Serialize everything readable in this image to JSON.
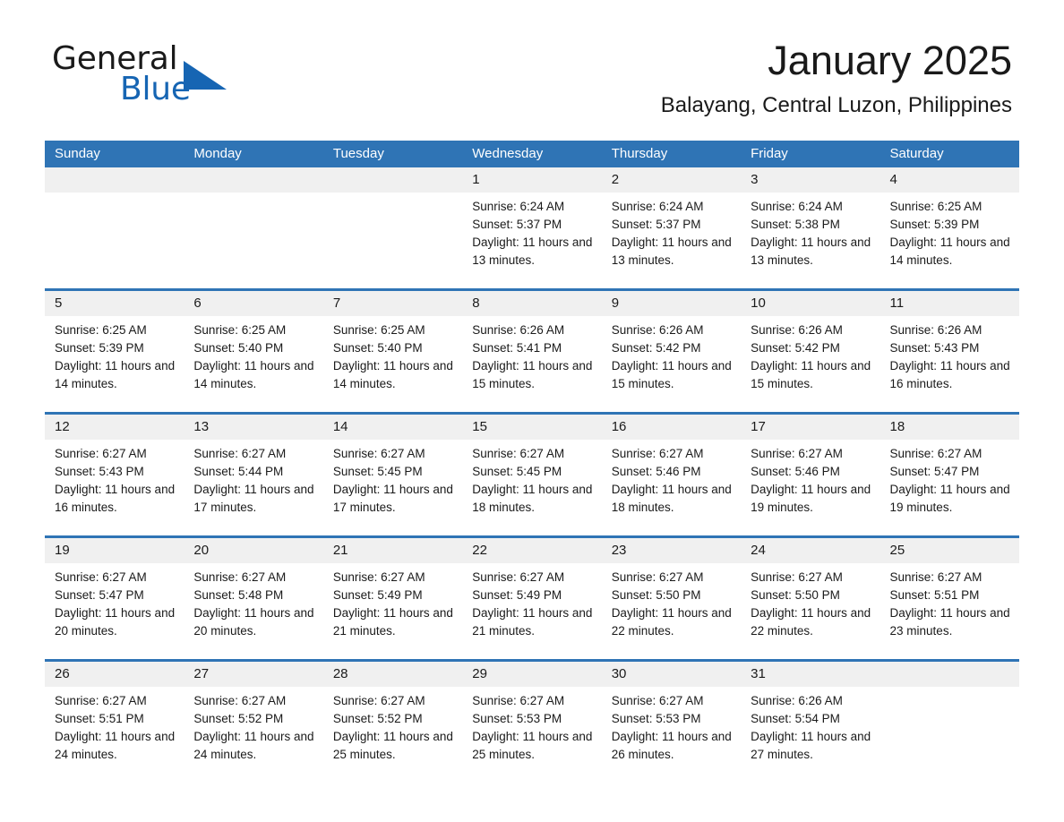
{
  "brand": {
    "name_part1": "General",
    "name_part2": "Blue",
    "accent_color": "#1665b3",
    "triangle_icon": "triangle-icon"
  },
  "header": {
    "month_title": "January 2025",
    "location": "Balayang, Central Luzon, Philippines"
  },
  "theme": {
    "header_blue": "#2f74b5",
    "day_band_gray": "#f0f0f0",
    "text_color": "#1a1a1a"
  },
  "weekdays": [
    "Sunday",
    "Monday",
    "Tuesday",
    "Wednesday",
    "Thursday",
    "Friday",
    "Saturday"
  ],
  "weeks": [
    [
      {
        "day": "",
        "empty": true
      },
      {
        "day": "",
        "empty": true
      },
      {
        "day": "",
        "empty": true
      },
      {
        "day": "1",
        "sunrise": "Sunrise: 6:24 AM",
        "sunset": "Sunset: 5:37 PM",
        "daylight": "Daylight: 11 hours and 13 minutes."
      },
      {
        "day": "2",
        "sunrise": "Sunrise: 6:24 AM",
        "sunset": "Sunset: 5:37 PM",
        "daylight": "Daylight: 11 hours and 13 minutes."
      },
      {
        "day": "3",
        "sunrise": "Sunrise: 6:24 AM",
        "sunset": "Sunset: 5:38 PM",
        "daylight": "Daylight: 11 hours and 13 minutes."
      },
      {
        "day": "4",
        "sunrise": "Sunrise: 6:25 AM",
        "sunset": "Sunset: 5:39 PM",
        "daylight": "Daylight: 11 hours and 14 minutes."
      }
    ],
    [
      {
        "day": "5",
        "sunrise": "Sunrise: 6:25 AM",
        "sunset": "Sunset: 5:39 PM",
        "daylight": "Daylight: 11 hours and 14 minutes."
      },
      {
        "day": "6",
        "sunrise": "Sunrise: 6:25 AM",
        "sunset": "Sunset: 5:40 PM",
        "daylight": "Daylight: 11 hours and 14 minutes."
      },
      {
        "day": "7",
        "sunrise": "Sunrise: 6:25 AM",
        "sunset": "Sunset: 5:40 PM",
        "daylight": "Daylight: 11 hours and 14 minutes."
      },
      {
        "day": "8",
        "sunrise": "Sunrise: 6:26 AM",
        "sunset": "Sunset: 5:41 PM",
        "daylight": "Daylight: 11 hours and 15 minutes."
      },
      {
        "day": "9",
        "sunrise": "Sunrise: 6:26 AM",
        "sunset": "Sunset: 5:42 PM",
        "daylight": "Daylight: 11 hours and 15 minutes."
      },
      {
        "day": "10",
        "sunrise": "Sunrise: 6:26 AM",
        "sunset": "Sunset: 5:42 PM",
        "daylight": "Daylight: 11 hours and 15 minutes."
      },
      {
        "day": "11",
        "sunrise": "Sunrise: 6:26 AM",
        "sunset": "Sunset: 5:43 PM",
        "daylight": "Daylight: 11 hours and 16 minutes."
      }
    ],
    [
      {
        "day": "12",
        "sunrise": "Sunrise: 6:27 AM",
        "sunset": "Sunset: 5:43 PM",
        "daylight": "Daylight: 11 hours and 16 minutes."
      },
      {
        "day": "13",
        "sunrise": "Sunrise: 6:27 AM",
        "sunset": "Sunset: 5:44 PM",
        "daylight": "Daylight: 11 hours and 17 minutes."
      },
      {
        "day": "14",
        "sunrise": "Sunrise: 6:27 AM",
        "sunset": "Sunset: 5:45 PM",
        "daylight": "Daylight: 11 hours and 17 minutes."
      },
      {
        "day": "15",
        "sunrise": "Sunrise: 6:27 AM",
        "sunset": "Sunset: 5:45 PM",
        "daylight": "Daylight: 11 hours and 18 minutes."
      },
      {
        "day": "16",
        "sunrise": "Sunrise: 6:27 AM",
        "sunset": "Sunset: 5:46 PM",
        "daylight": "Daylight: 11 hours and 18 minutes."
      },
      {
        "day": "17",
        "sunrise": "Sunrise: 6:27 AM",
        "sunset": "Sunset: 5:46 PM",
        "daylight": "Daylight: 11 hours and 19 minutes."
      },
      {
        "day": "18",
        "sunrise": "Sunrise: 6:27 AM",
        "sunset": "Sunset: 5:47 PM",
        "daylight": "Daylight: 11 hours and 19 minutes."
      }
    ],
    [
      {
        "day": "19",
        "sunrise": "Sunrise: 6:27 AM",
        "sunset": "Sunset: 5:47 PM",
        "daylight": "Daylight: 11 hours and 20 minutes."
      },
      {
        "day": "20",
        "sunrise": "Sunrise: 6:27 AM",
        "sunset": "Sunset: 5:48 PM",
        "daylight": "Daylight: 11 hours and 20 minutes."
      },
      {
        "day": "21",
        "sunrise": "Sunrise: 6:27 AM",
        "sunset": "Sunset: 5:49 PM",
        "daylight": "Daylight: 11 hours and 21 minutes."
      },
      {
        "day": "22",
        "sunrise": "Sunrise: 6:27 AM",
        "sunset": "Sunset: 5:49 PM",
        "daylight": "Daylight: 11 hours and 21 minutes."
      },
      {
        "day": "23",
        "sunrise": "Sunrise: 6:27 AM",
        "sunset": "Sunset: 5:50 PM",
        "daylight": "Daylight: 11 hours and 22 minutes."
      },
      {
        "day": "24",
        "sunrise": "Sunrise: 6:27 AM",
        "sunset": "Sunset: 5:50 PM",
        "daylight": "Daylight: 11 hours and 22 minutes."
      },
      {
        "day": "25",
        "sunrise": "Sunrise: 6:27 AM",
        "sunset": "Sunset: 5:51 PM",
        "daylight": "Daylight: 11 hours and 23 minutes."
      }
    ],
    [
      {
        "day": "26",
        "sunrise": "Sunrise: 6:27 AM",
        "sunset": "Sunset: 5:51 PM",
        "daylight": "Daylight: 11 hours and 24 minutes."
      },
      {
        "day": "27",
        "sunrise": "Sunrise: 6:27 AM",
        "sunset": "Sunset: 5:52 PM",
        "daylight": "Daylight: 11 hours and 24 minutes."
      },
      {
        "day": "28",
        "sunrise": "Sunrise: 6:27 AM",
        "sunset": "Sunset: 5:52 PM",
        "daylight": "Daylight: 11 hours and 25 minutes."
      },
      {
        "day": "29",
        "sunrise": "Sunrise: 6:27 AM",
        "sunset": "Sunset: 5:53 PM",
        "daylight": "Daylight: 11 hours and 25 minutes."
      },
      {
        "day": "30",
        "sunrise": "Sunrise: 6:27 AM",
        "sunset": "Sunset: 5:53 PM",
        "daylight": "Daylight: 11 hours and 26 minutes."
      },
      {
        "day": "31",
        "sunrise": "Sunrise: 6:26 AM",
        "sunset": "Sunset: 5:54 PM",
        "daylight": "Daylight: 11 hours and 27 minutes."
      },
      {
        "day": "",
        "empty": true
      }
    ]
  ]
}
